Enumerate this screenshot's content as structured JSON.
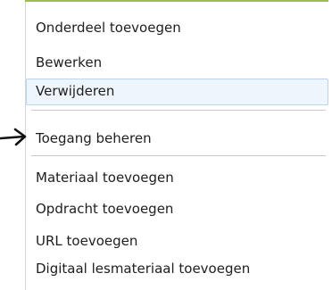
{
  "menu": {
    "items": [
      {
        "label": "Onderdeel toevoegen"
      },
      {
        "label": "Bewerken"
      },
      {
        "label": "Verwijderen"
      },
      {
        "label": "Toegang beheren"
      },
      {
        "label": "Materiaal toevoegen"
      },
      {
        "label": "Opdracht toevoegen"
      },
      {
        "label": "URL toevoegen"
      },
      {
        "label": "Digitaal lesmateriaal toevoegen"
      }
    ],
    "highlighted_item": "Verwijderen"
  },
  "annotation": {
    "icon": "arrow-right-icon",
    "points_to": "Toegang beheren"
  },
  "colors": {
    "highlight_background": "#eef5fc",
    "highlight_border": "#b9d4ef",
    "top_accent": "#9bbf4a"
  }
}
